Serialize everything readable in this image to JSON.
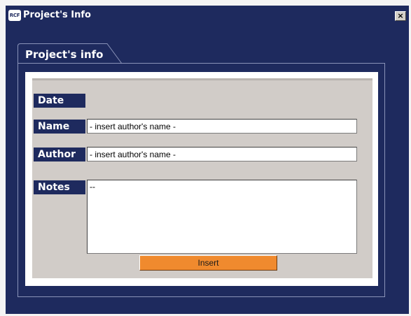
{
  "window": {
    "title": "Project's Info",
    "logo_text": "RCF",
    "close_symbol": "×",
    "icons": {
      "close": "close-icon",
      "logo": "app-logo-icon"
    }
  },
  "tab": {
    "label": "Project's info"
  },
  "form": {
    "date": {
      "label": "Date"
    },
    "name": {
      "label": "Name",
      "value": "- insert author's name -"
    },
    "author": {
      "label": "Author",
      "value": "- insert author's name -"
    },
    "notes": {
      "label": "Notes",
      "value": "--"
    },
    "insert_label": "Insert"
  },
  "colors": {
    "frame": "#1e2a5e",
    "panel": "#d1ccc8",
    "button": "#f08a2e"
  }
}
